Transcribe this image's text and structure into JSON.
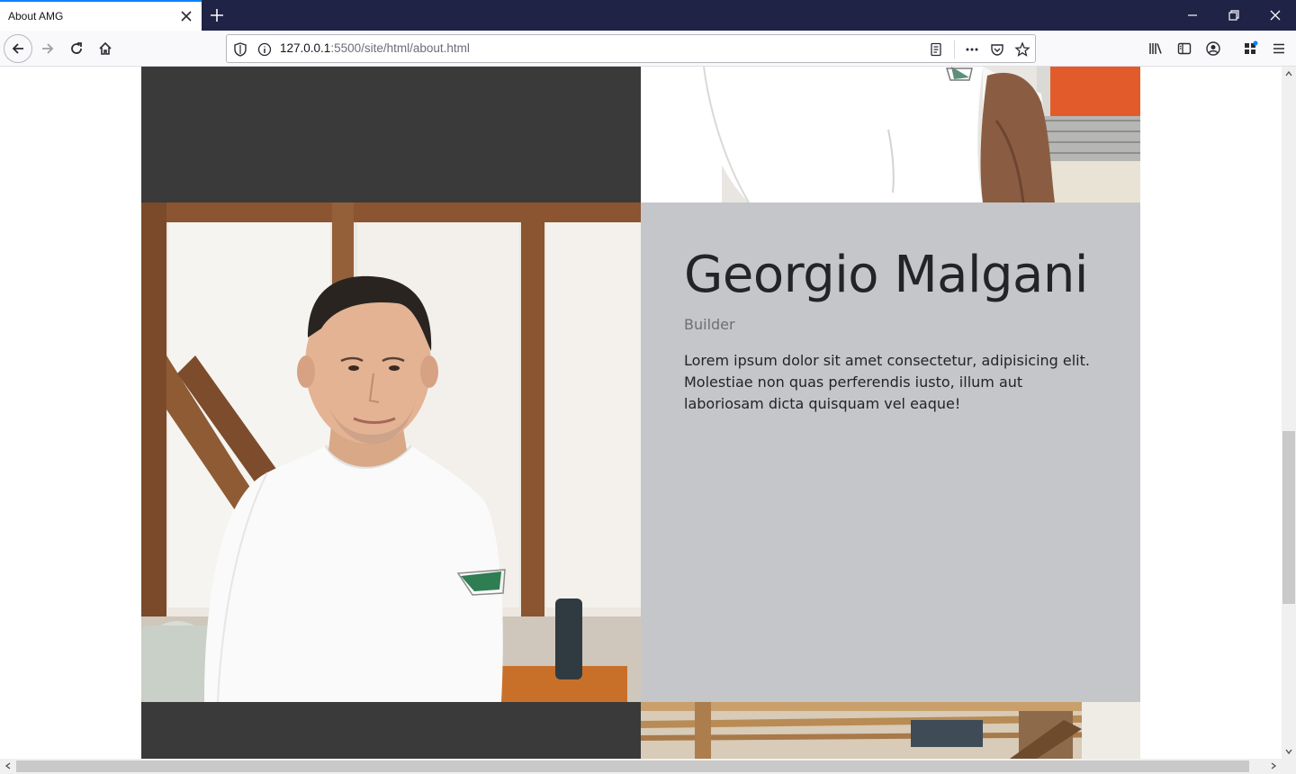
{
  "browser": {
    "tab_title": "About AMG",
    "url_host": "127.0.0.1",
    "url_rest": ":5500/site/html/about.html"
  },
  "member": {
    "name": "Georgio Malgani",
    "role": "Builder",
    "bio": "Lorem ipsum dolor sit amet consectetur, adipisicing elit. Molestiae non quas perferendis iusto, illum aut laboriosam dicta quisquam vel eaque!"
  },
  "colors": {
    "dark_panel": "#3a3a3a",
    "grey_panel": "#c5c6c9",
    "tabbar": "#1f2346",
    "tab_accent": "#0a84ff"
  }
}
